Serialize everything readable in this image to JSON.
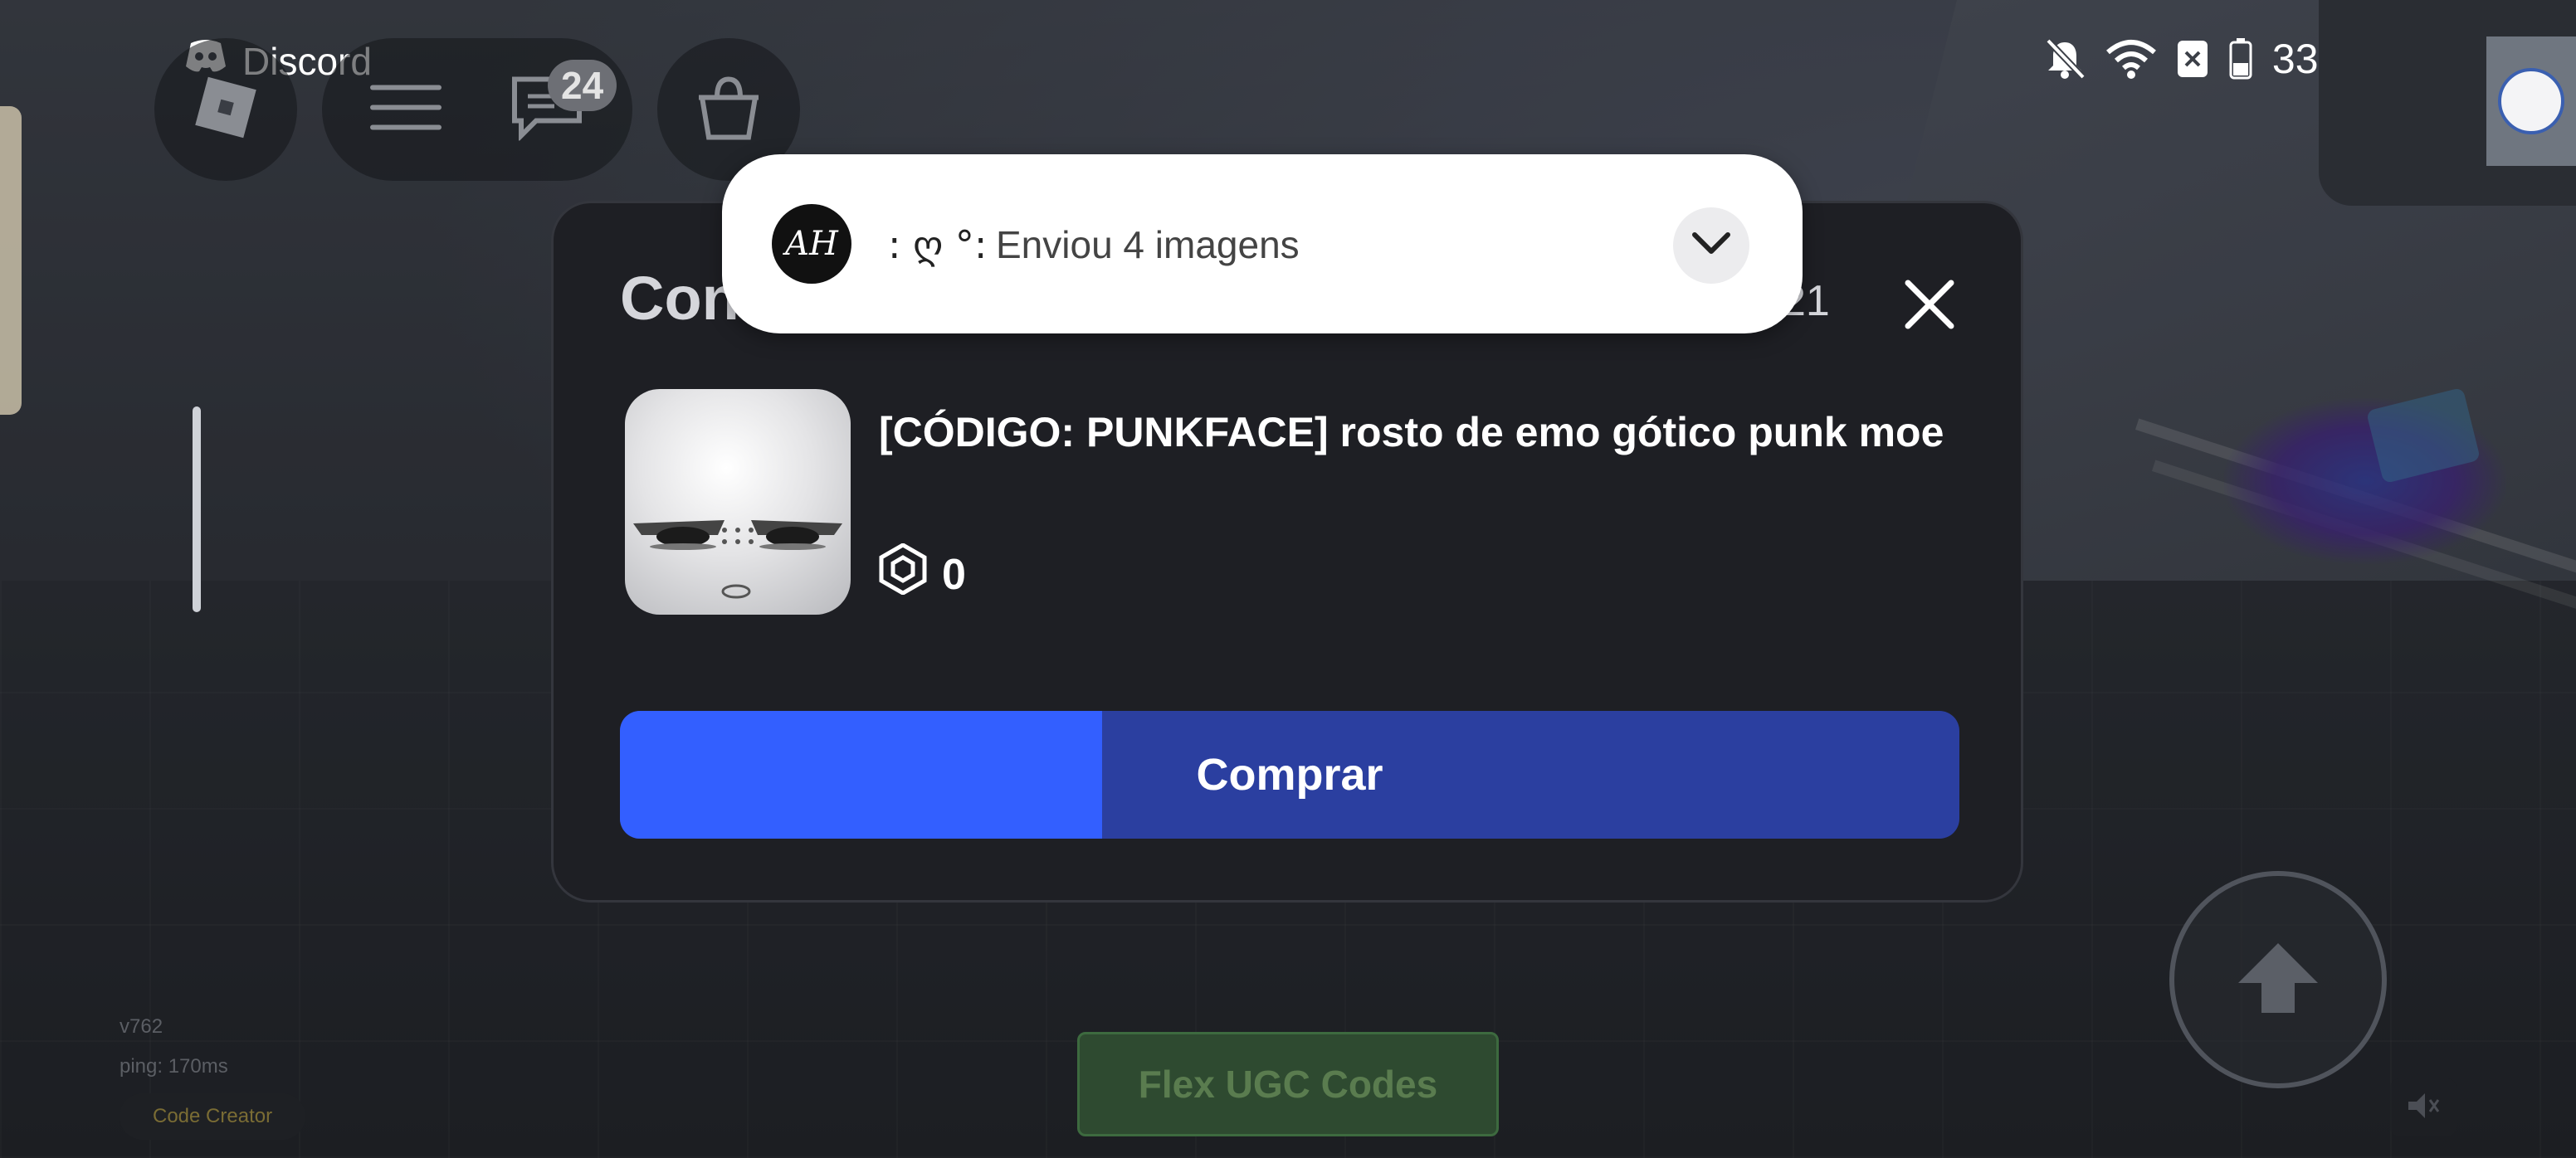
{
  "status_bar": {
    "app_name": "Discord",
    "battery": "33%",
    "icons": [
      "discord-icon",
      "bell-off-icon",
      "wifi-icon",
      "sim-blocked-icon",
      "battery-icon"
    ]
  },
  "game_topbar": {
    "chat_badge": "24",
    "icons": [
      "roblox-logo-icon",
      "hamburger-menu-icon",
      "chat-icon",
      "shopping-bag-icon"
    ]
  },
  "purchase_modal": {
    "title": "Con",
    "hidden_value": "21",
    "item_name": "[CÓDIGO: PUNKFACE] rosto de emo gótico punk moe",
    "price": "0",
    "buy_label": "Comprar",
    "buy_hold_progress": 0.36,
    "icons": [
      "close-icon",
      "robux-icon"
    ]
  },
  "notification": {
    "sender": ": ღ °:",
    "message": "Enviou 4 imagens",
    "avatar_text": "AH",
    "icons": [
      "chevron-down-icon"
    ]
  },
  "game_hud": {
    "version": "v762",
    "ping": "ping: 170ms",
    "code_creator": "Code Creator",
    "flex_button": "Flex UGC Codes",
    "icons": [
      "jump-arrow-icon",
      "mute-icon"
    ]
  },
  "colors": {
    "buy_fill": "#335fff",
    "buy_track": "#2b3fa0",
    "modal_bg": "#1e1f24",
    "notification_bg": "#ffffff"
  }
}
